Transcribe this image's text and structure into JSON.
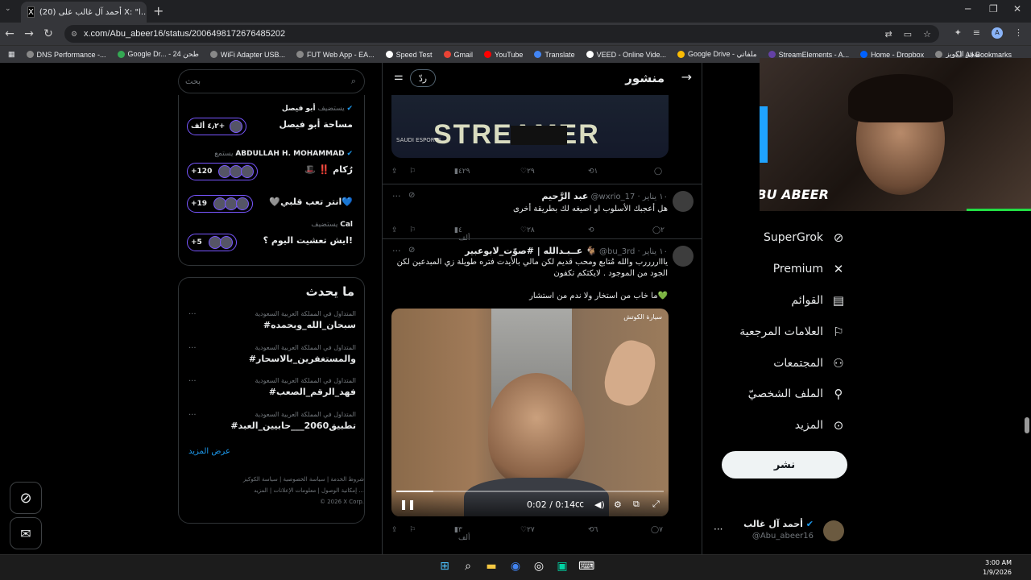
{
  "browser": {
    "tab_title": "أحمد آل غالب على X: \"ا...",
    "tab_count_prefix": "(20)",
    "url": "x.com/Abu_abeer16/status/2006498172676485202",
    "bookmarks": [
      "DNS Performance -...",
      "Google Dr... - طحن 24",
      "WiFi Adapter USB...",
      "FUT Web App - EA...",
      "Speed Test",
      "Gmail",
      "YouTube",
      "Translate",
      "VEED - Online Vide...",
      "Google Drive - ملفاتي",
      "StreamElements - A...",
      "Home - Dropbox",
      "متجر الكويز"
    ],
    "all_bookmarks": "All Bookmarks"
  },
  "header": {
    "title": "منشور",
    "reply": "ردّ"
  },
  "nav": {
    "items": [
      "SuperGrok",
      "Premium",
      "القوائم",
      "العلامات المرجعية",
      "المجتمعات",
      "الملف الشخصيّ",
      "المزيد"
    ],
    "post_button": "نشر"
  },
  "profile": {
    "name": "أحمد آل غالب",
    "handle": "@Abu_abeer16"
  },
  "webcam": {
    "brand": "ABU ABEER"
  },
  "top_media": {
    "banner_text": "STREAMER",
    "sponsor": "SAUDI ESPORTS"
  },
  "actions_top": {
    "views": "٤٢٩",
    "likes": "٢٩",
    "reposts": "١",
    "replies": ""
  },
  "posts": [
    {
      "name": "عبد الرَّحيم",
      "handle": "@wxrio_17",
      "date": "١٠ يناير",
      "text": "هل أعجبك الأسلوب او اصيغه لك بطريقة أخرى",
      "views": "٤ ألف",
      "likes": "٢٨",
      "reposts": "",
      "replies": "٢"
    },
    {
      "name": "عــبـدالله | #صوّت_لابوعبير 🐐",
      "handle": "@bu_3rd",
      "date": "١٠ يناير",
      "text1": "ياااررررب والله مُتابع ومحب قديم لكن مالي بالأيدت فتره طويلة زي المبدعين لكن الجود من الموجود . لايكثكم تكفون",
      "text2": "ما خاب من استخار ولا ندم من استشار💚",
      "views": "٣ ألف",
      "likes": "٢٧",
      "reposts": "٦",
      "replies": "٧"
    }
  ],
  "video": {
    "time": "0:02 / 0:14",
    "progress": 0.14,
    "watermark": "سيارة الكوتش"
  },
  "sidebar": {
    "search_placeholder": "بحث",
    "spaces": [
      {
        "role": "يستضيف",
        "host": "أبو فيصل",
        "title": "مساحة أبو فيصل",
        "count": "٤٫٢ ألف+"
      },
      {
        "role": "يستمع",
        "host": "ABDULLAH H. MOHAMMAD",
        "title": "🎩 ‼️ رُكام",
        "count": "+120"
      },
      {
        "role": "",
        "host": "",
        "title": "🩶انتر تعب قلبي💙",
        "count": "+19"
      },
      {
        "role": "يستضيف",
        "host": "Cal",
        "title": "ايش تعشيت اليوم ؟!",
        "count": "+5"
      }
    ],
    "trends_title": "ما يحدث",
    "trends": [
      {
        "category": "المتداول في المملكة العربية السعودية",
        "tag": "#سبحان_الله_وبحمده"
      },
      {
        "category": "المتداول في المملكة العربية السعودية",
        "tag": "#والمستغفرين_بالاسحار"
      },
      {
        "category": "المتداول في المملكة العربية السعودية",
        "tag": "#فهد_الرقم_الصعب"
      },
      {
        "category": "المتداول في المملكة العربية السعودية",
        "tag": "#تطبيق2060___حابيين_العبد"
      }
    ],
    "show_more": "عرض المزيد",
    "footer": [
      "شروط الخدمة",
      "سياسة الخصوصية",
      "سياسة الكوكيز",
      "إمكانية الوصول",
      "معلومات الإعلانات",
      "المزيد ...",
      "© 2026 X Corp."
    ]
  },
  "taskbar": {
    "time": "3:00 AM",
    "date": "1/9/2026"
  }
}
